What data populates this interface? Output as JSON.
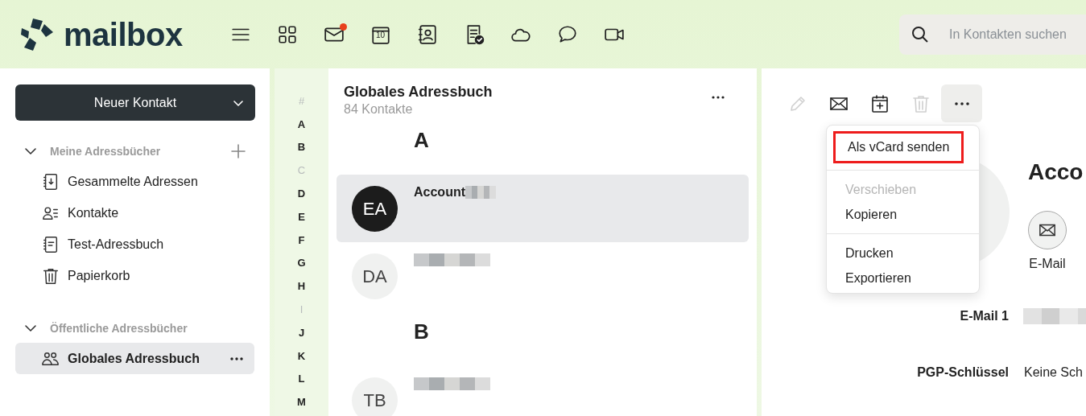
{
  "header": {
    "logo": "mailbox",
    "nav": [
      {
        "kind": "menu"
      },
      {
        "kind": "apps"
      },
      {
        "kind": "mail",
        "notification": true
      },
      {
        "kind": "calendar",
        "text": "10"
      },
      {
        "kind": "contacts"
      },
      {
        "kind": "tasks"
      },
      {
        "kind": "cloud"
      },
      {
        "kind": "chat"
      },
      {
        "kind": "video"
      }
    ],
    "search": {
      "placeholder": "In Kontakten suchen"
    }
  },
  "sidebar": {
    "new_contact_button": "Neuer Kontakt",
    "sections": [
      {
        "title": "Meine Adressbücher",
        "expanded": true,
        "can_add": true,
        "items": [
          {
            "label": "Gesammelte Adressen",
            "kind": "collected",
            "selected": false
          },
          {
            "label": "Kontakte",
            "kind": "contacts",
            "selected": false
          },
          {
            "label": "Test-Adressbuch",
            "kind": "book",
            "selected": false
          },
          {
            "label": "Papierkorb",
            "kind": "trash",
            "selected": false
          }
        ]
      },
      {
        "title": "Öffentliche Adressbücher",
        "expanded": true,
        "can_add": false,
        "items": [
          {
            "label": "Globales Adressbuch",
            "kind": "group",
            "selected": true
          }
        ]
      }
    ]
  },
  "alphabet": [
    {
      "letter": "#",
      "disabled": true
    },
    {
      "letter": "A",
      "disabled": false
    },
    {
      "letter": "B",
      "disabled": false
    },
    {
      "letter": "C",
      "disabled": true
    },
    {
      "letter": "D",
      "disabled": false
    },
    {
      "letter": "E",
      "disabled": false
    },
    {
      "letter": "F",
      "disabled": false
    },
    {
      "letter": "G",
      "disabled": false
    },
    {
      "letter": "H",
      "disabled": false
    },
    {
      "letter": "I",
      "disabled": true
    },
    {
      "letter": "J",
      "disabled": false
    },
    {
      "letter": "K",
      "disabled": false
    },
    {
      "letter": "L",
      "disabled": false
    },
    {
      "letter": "M",
      "disabled": false
    }
  ],
  "contact_list": {
    "title": "Globales Adressbuch",
    "count": "84 Kontakte",
    "groups": [
      {
        "letter": "A",
        "contacts": [
          {
            "initials": "EA",
            "name": "Account",
            "redacted": true,
            "selected": true
          },
          {
            "initials": "DA",
            "redacted": true,
            "selected": false
          }
        ]
      },
      {
        "letter": "B",
        "contacts": [
          {
            "initials": "TB",
            "redacted": true,
            "selected": false
          }
        ]
      }
    ]
  },
  "detail": {
    "toolbar": [
      {
        "kind": "edit",
        "disabled": true
      },
      {
        "kind": "mail",
        "disabled": false
      },
      {
        "kind": "calendar",
        "disabled": false
      },
      {
        "kind": "delete",
        "disabled": true
      },
      {
        "kind": "more",
        "disabled": false,
        "active": true
      }
    ],
    "menu": [
      [
        {
          "label": "Als vCard senden",
          "disabled": false,
          "highlighted": true
        }
      ],
      [
        {
          "label": "Verschieben",
          "disabled": true,
          "highlighted": false
        },
        {
          "label": "Kopieren",
          "disabled": false,
          "highlighted": false
        }
      ],
      [
        {
          "label": "Drucken",
          "disabled": false,
          "highlighted": false
        },
        {
          "label": "Exportieren",
          "disabled": false,
          "highlighted": false
        }
      ]
    ],
    "name": "Acco",
    "actions": [
      {
        "label": "E-Mail"
      }
    ],
    "fields": [
      {
        "label": "E-Mail 1",
        "redacted": true
      },
      {
        "label": "PGP-Schlüssel",
        "value": "Keine Sch"
      }
    ]
  }
}
